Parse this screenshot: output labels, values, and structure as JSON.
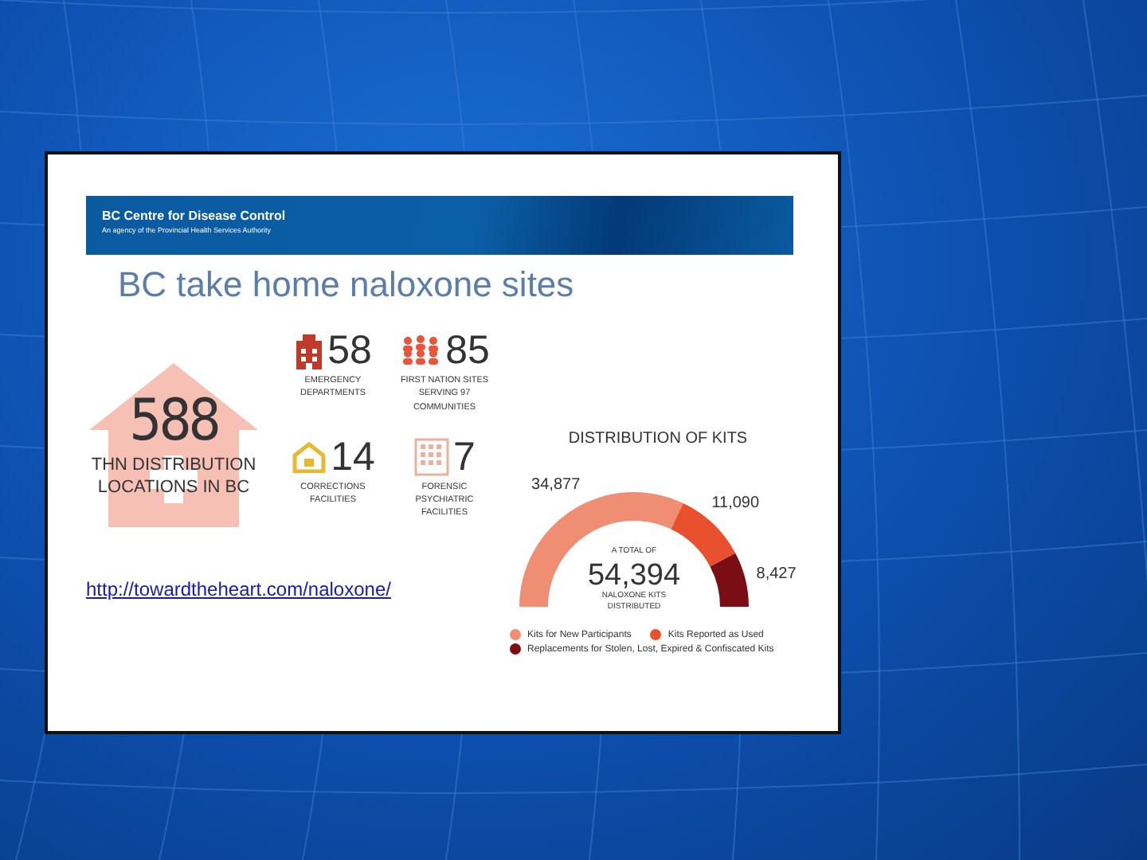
{
  "banner": {
    "title": "BC Centre for Disease Control",
    "subtitle": "An agency of the Provincial Health Services Authority"
  },
  "heading": "BC take home naloxone sites",
  "total_locations": {
    "value": "588",
    "label": "THN DISTRIBUTION LOCATIONS IN BC"
  },
  "stats": [
    {
      "kind": "hospital",
      "value": "58",
      "label": "EMERGENCY DEPARTMENTS",
      "color": "#c0392b"
    },
    {
      "kind": "people",
      "value": "85",
      "label": "FIRST NATION SITES SERVING 97 COMMUNITIES",
      "color": "#e8553a"
    },
    {
      "kind": "house",
      "value": "14",
      "label": "CORRECTIONS FACILITIES",
      "color": "#e8b830"
    },
    {
      "kind": "building",
      "value": "7",
      "label": "FORENSIC PSYCHIATRIC FACILITIES",
      "color": "#eab0a0"
    }
  ],
  "link": "http://towardtheheart.com/naloxone/",
  "distribution": {
    "title": "DISTRIBUTION OF KITS",
    "total_prefix": "A TOTAL OF",
    "total": "54,394",
    "total_suffix": "NALOXONE KITS DISTRIBUTED",
    "legend": [
      {
        "color": "#f08e74"
      },
      {
        "color": "#e8502e"
      },
      {
        "color": "#7a0e14"
      }
    ],
    "chart_data": {
      "type": "donut",
      "categories": [
        "Kits for New Participants",
        "Kits Reported as Used",
        "Replacements for Stolen, Lost, Expired & Confiscated Kits"
      ],
      "values": [
        34877,
        11090,
        8427
      ],
      "value_labels": [
        "34,877",
        "11,090",
        "8,427"
      ]
    }
  }
}
